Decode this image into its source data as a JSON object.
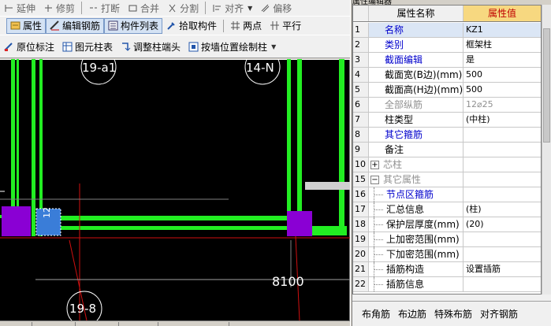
{
  "toolbar": {
    "row0": [
      "延伸",
      "修剪",
      "打断",
      "合并",
      "分割",
      "对齐",
      "偏移"
    ],
    "row1": {
      "attributes": "属性",
      "edit_rebar": "编辑钢筋",
      "component_list": "构件列表",
      "pick_component": "拾取构件",
      "two_points": "两点",
      "parallel": "平行"
    },
    "row2": {
      "in_place_label": "原位标注",
      "element_column_table": "图元柱表",
      "adjust_column_end": "调整柱端头",
      "draw_by_position": "按墙位置绘制柱"
    }
  },
  "canvas": {
    "axis_labels": [
      "19-a1",
      "14-N",
      "19-8"
    ],
    "dimension_text": "8100",
    "column_tag": "12"
  },
  "property_panel": {
    "title": "属性编辑器",
    "header_name": "属性名称",
    "header_value": "属性值",
    "rows": [
      {
        "num": "1",
        "name": "名称",
        "value": "KZ1",
        "style": "blue",
        "level": 1
      },
      {
        "num": "2",
        "name": "类别",
        "value": "框架柱",
        "style": "blue",
        "level": 1
      },
      {
        "num": "3",
        "name": "截面编辑",
        "value": "是",
        "style": "blue",
        "level": 1
      },
      {
        "num": "4",
        "name": "截面宽(B边)(mm)",
        "value": "500",
        "style": "normal",
        "level": 1
      },
      {
        "num": "5",
        "name": "截面高(H边)(mm)",
        "value": "500",
        "style": "normal",
        "level": 1
      },
      {
        "num": "6",
        "name": "全部纵筋",
        "value": "12⌀25",
        "style": "grey",
        "level": 1
      },
      {
        "num": "7",
        "name": "柱类型",
        "value": "(中柱)",
        "style": "normal",
        "level": 1
      },
      {
        "num": "8",
        "name": "其它箍筋",
        "value": "",
        "style": "blue",
        "level": 1
      },
      {
        "num": "9",
        "name": "备注",
        "value": "",
        "style": "normal",
        "level": 1
      },
      {
        "num": "10",
        "name": "芯柱",
        "value": "",
        "style": "grey",
        "level": 0,
        "expander": "+"
      },
      {
        "num": "15",
        "name": "其它属性",
        "value": "",
        "style": "grey",
        "level": 0,
        "expander": "−"
      },
      {
        "num": "16",
        "name": "节点区箍筋",
        "value": "",
        "style": "blue",
        "level": 2
      },
      {
        "num": "17",
        "name": "汇总信息",
        "value": "(柱)",
        "style": "normal",
        "level": 2
      },
      {
        "num": "18",
        "name": "保护层厚度(mm)",
        "value": "(20)",
        "style": "normal",
        "level": 2
      },
      {
        "num": "19",
        "name": "上加密范围(mm)",
        "value": "",
        "style": "normal",
        "level": 2
      },
      {
        "num": "20",
        "name": "下加密范围(mm)",
        "value": "",
        "style": "normal",
        "level": 2
      },
      {
        "num": "21",
        "name": "插筋构造",
        "value": "设置插筋",
        "style": "normal",
        "level": 2
      },
      {
        "num": "22",
        "name": "插筋信息",
        "value": "",
        "style": "normal",
        "level": 2
      }
    ],
    "footer_tabs": [
      "布角筋",
      "布边筋",
      "特殊布筋",
      "对齐钢筋"
    ]
  },
  "colors": {
    "green": "#22ee22",
    "purple": "#8a00d4",
    "blue_column": "#3a7dd8",
    "header_value_bg": "#f7d880",
    "selected_row_bg": "#dbe6f5"
  }
}
